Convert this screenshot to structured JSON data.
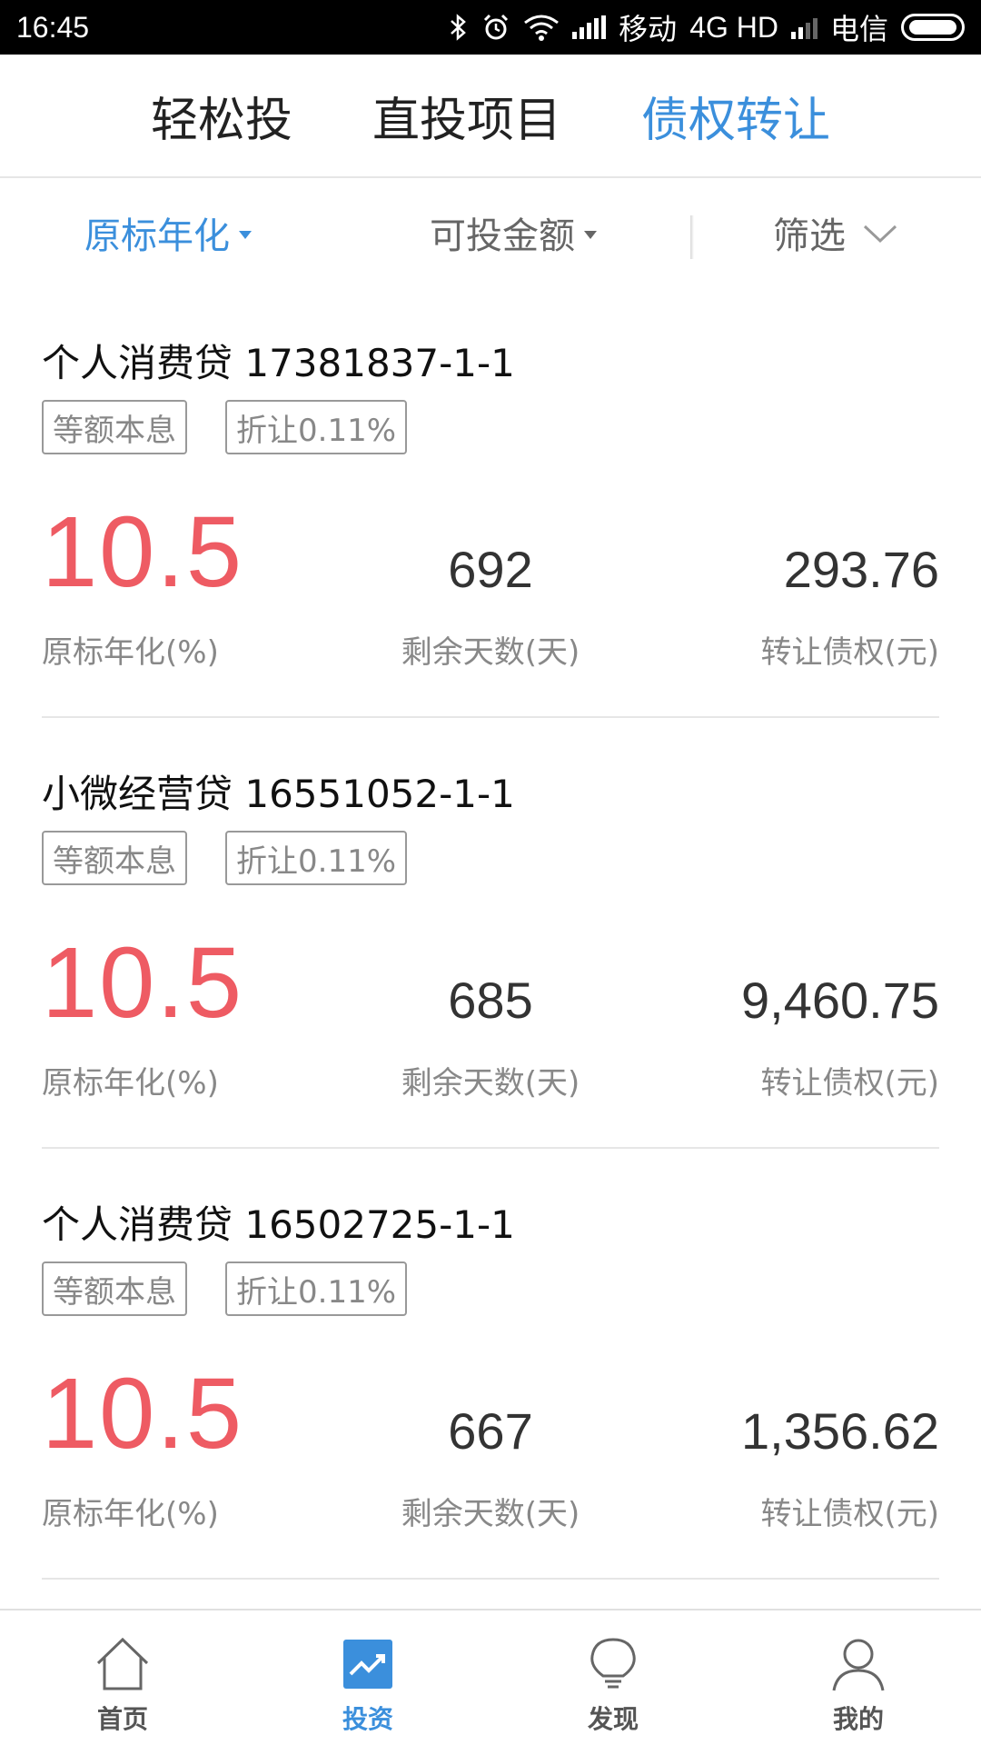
{
  "status_bar": {
    "time": "16:45",
    "carrier1": "移动",
    "network": "4G HD",
    "carrier2": "电信",
    "icons": [
      "bluetooth-icon",
      "alarm-icon",
      "wifi-icon",
      "signal-icon",
      "battery-icon"
    ]
  },
  "top_tabs": [
    {
      "label": "轻松投",
      "active": false
    },
    {
      "label": "直投项目",
      "active": false
    },
    {
      "label": "债权转让",
      "active": true
    }
  ],
  "filters": {
    "rate": "原标年化",
    "amount": "可投金额",
    "screen": "筛选"
  },
  "products": [
    {
      "title": "个人消费贷 17381837-1-1",
      "tags": [
        "等额本息",
        "折让0.11%"
      ],
      "rate": "10.5",
      "days": "692",
      "amount": "293.76",
      "rate_label": "原标年化(%)",
      "days_label": "剩余天数(天)",
      "amount_label": "转让债权(元)"
    },
    {
      "title": "小微经营贷 16551052-1-1",
      "tags": [
        "等额本息",
        "折让0.11%"
      ],
      "rate": "10.5",
      "days": "685",
      "amount": "9,460.75",
      "rate_label": "原标年化(%)",
      "days_label": "剩余天数(天)",
      "amount_label": "转让债权(元)"
    },
    {
      "title": "个人消费贷 16502725-1-1",
      "tags": [
        "等额本息",
        "折让0.11%"
      ],
      "rate": "10.5",
      "days": "667",
      "amount": "1,356.62",
      "rate_label": "原标年化(%)",
      "days_label": "剩余天数(天)",
      "amount_label": "转让债权(元)"
    }
  ],
  "bottom_nav": [
    {
      "label": "首页",
      "icon": "home-icon",
      "active": false
    },
    {
      "label": "投资",
      "icon": "invest-chart-icon",
      "active": true
    },
    {
      "label": "发现",
      "icon": "lightbulb-icon",
      "active": false
    },
    {
      "label": "我的",
      "icon": "user-icon",
      "active": false
    }
  ],
  "colors": {
    "accent": "#3b8fdc",
    "rate": "#ee5b63"
  }
}
